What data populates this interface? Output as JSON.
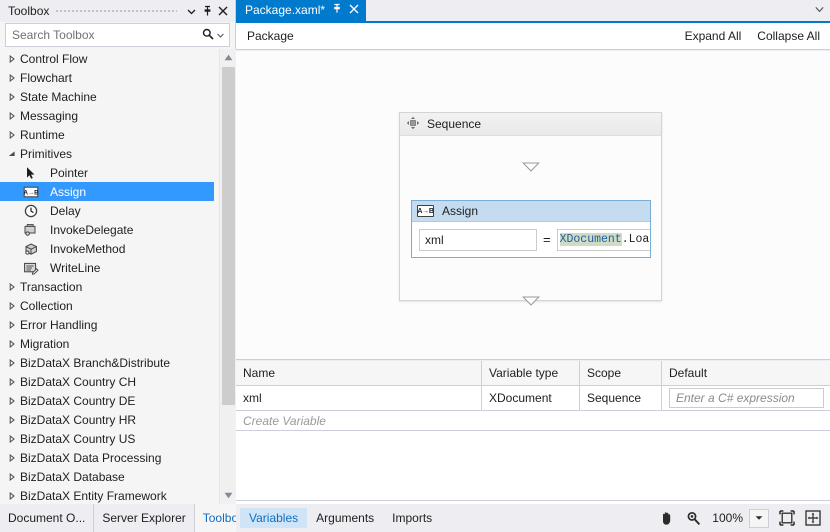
{
  "toolbox": {
    "title": "Toolbox",
    "header_icons": [
      {
        "name": "chevron-down-icon",
        "glyph": "▾"
      },
      {
        "name": "pin-icon",
        "glyph": "⚲"
      },
      {
        "name": "close-icon",
        "glyph": "✕"
      }
    ],
    "search": {
      "placeholder": "Search Toolbox",
      "icon": "search-icon",
      "dropdown_icon": "chevron-down-icon"
    },
    "items": [
      {
        "label": "Control Flow",
        "type": "group",
        "expanded": false
      },
      {
        "label": "Flowchart",
        "type": "group",
        "expanded": false
      },
      {
        "label": "State Machine",
        "type": "group",
        "expanded": false
      },
      {
        "label": "Messaging",
        "type": "group",
        "expanded": false
      },
      {
        "label": "Runtime",
        "type": "group",
        "expanded": false
      },
      {
        "label": "Primitives",
        "type": "group",
        "expanded": true
      },
      {
        "label": "Pointer",
        "type": "item",
        "icon": "pointer-icon",
        "selected": false
      },
      {
        "label": "Assign",
        "type": "item",
        "icon": "assign-ab-icon",
        "selected": true
      },
      {
        "label": "Delay",
        "type": "item",
        "icon": "clock-icon",
        "selected": false
      },
      {
        "label": "InvokeDelegate",
        "type": "item",
        "icon": "invoke-delegate-icon",
        "selected": false
      },
      {
        "label": "InvokeMethod",
        "type": "item",
        "icon": "invoke-method-icon",
        "selected": false
      },
      {
        "label": "WriteLine",
        "type": "item",
        "icon": "write-line-icon",
        "selected": false
      },
      {
        "label": "Transaction",
        "type": "group",
        "expanded": false
      },
      {
        "label": "Collection",
        "type": "group",
        "expanded": false
      },
      {
        "label": "Error Handling",
        "type": "group",
        "expanded": false
      },
      {
        "label": "Migration",
        "type": "group",
        "expanded": false
      },
      {
        "label": "BizDataX Branch&Distribute",
        "type": "group",
        "expanded": false
      },
      {
        "label": "BizDataX Country CH",
        "type": "group",
        "expanded": false
      },
      {
        "label": "BizDataX Country DE",
        "type": "group",
        "expanded": false
      },
      {
        "label": "BizDataX Country HR",
        "type": "group",
        "expanded": false
      },
      {
        "label": "BizDataX Country US",
        "type": "group",
        "expanded": false
      },
      {
        "label": "BizDataX Data Processing",
        "type": "group",
        "expanded": false
      },
      {
        "label": "BizDataX Database",
        "type": "group",
        "expanded": false
      },
      {
        "label": "BizDataX Entity Framework",
        "type": "group",
        "expanded": false
      }
    ],
    "bottom_tabs": [
      {
        "label": "Document O...",
        "active": false
      },
      {
        "label": "Server Explorer",
        "active": false
      },
      {
        "label": "Toolbox",
        "active": true
      }
    ]
  },
  "editor": {
    "tab": {
      "title": "Package.xaml*",
      "pin_icon": "pin-icon",
      "close_icon": "close-icon"
    },
    "tabstrip_overflow_icon": "chevron-down-icon",
    "breadcrumb": "Package",
    "expand_all": "Expand All",
    "collapse_all": "Collapse All"
  },
  "designer": {
    "sequence": {
      "title": "Sequence",
      "icon": "sequence-icon"
    },
    "assign": {
      "title": "Assign",
      "icon": "assign-ab-icon",
      "badge": "A→B",
      "to_value": "xml",
      "operator": "=",
      "expression_selected": "XDocument",
      "expression_rest": ".Load("
    }
  },
  "variables_grid": {
    "columns": [
      "Name",
      "Variable type",
      "Scope",
      "Default"
    ],
    "rows": [
      {
        "name": "xml",
        "variable_type": "XDocument",
        "scope": "Sequence",
        "default_placeholder": "Enter a C# expression"
      }
    ],
    "create_row_label": "Create Variable"
  },
  "status_bar": {
    "tabs": [
      {
        "label": "Variables",
        "active": true
      },
      {
        "label": "Arguments",
        "active": false
      },
      {
        "label": "Imports",
        "active": false
      }
    ],
    "pan_icon": "pan-hand-icon",
    "zoom_icon": "magnifier-icon",
    "zoom_level": "100%",
    "zoom_dropdown_icon": "chevron-down-icon",
    "fit_to_screen_icon": "fit-to-screen-icon",
    "expand_all_icon": "expand-canvas-icon"
  },
  "colors": {
    "accent_blue": "#007acc",
    "selection_blue": "#3399ff",
    "link_blue": "#0e70c0",
    "panel_bg": "#eeeef2",
    "canvas_bg": "#fcfcfc",
    "assign_header": "#c5dcf0",
    "assign_border": "#7aadd4",
    "expr_selection": "#cfdbc5",
    "status_tab_active": "#cfe4f7"
  }
}
